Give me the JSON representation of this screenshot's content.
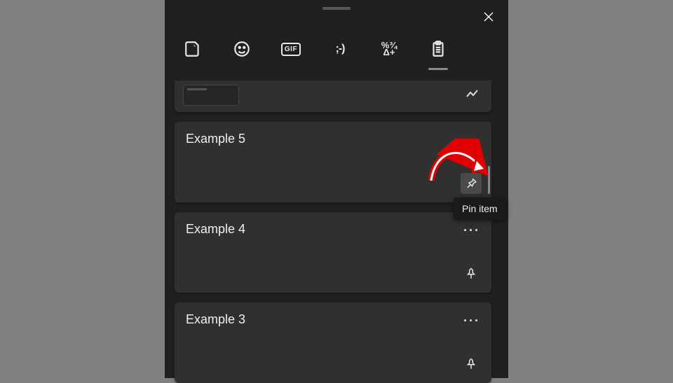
{
  "tabs": {
    "sticker": "sticker",
    "emoji": "emoji",
    "gif_label": "GIF",
    "kaomoji_label": ";-)",
    "symbols_line1": "%¾",
    "symbols_line2": "Δ+",
    "clipboard": "clipboard"
  },
  "items": [
    {
      "title": "Example 5"
    },
    {
      "title": "Example 4"
    },
    {
      "title": "Example 3"
    }
  ],
  "tooltip": "Pin item"
}
